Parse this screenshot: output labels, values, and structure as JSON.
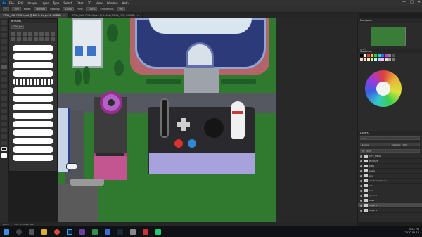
{
  "menubar": {
    "items": [
      "File",
      "Edit",
      "Image",
      "Layer",
      "Type",
      "Select",
      "Filter",
      "3D",
      "View",
      "Window",
      "Help"
    ],
    "window_controls": [
      "—",
      "□",
      "✕"
    ]
  },
  "options": {
    "size": "100",
    "mode_label": "Mode:",
    "mode": "Normal",
    "opacity_label": "Opacity:",
    "opacity": "100%",
    "flow_label": "Flow:",
    "flow": "100%",
    "smoothing_label": "Smoothing:",
    "smoothing": "0%"
  },
  "tabs": [
    {
      "label": "STRA_MAP FIN23.psd @ 200% (Layer 1, RGB/8)",
      "active": true
    },
    {
      "label": "STRA_MAP PIXELS.psd @ 100% (FINAL_REF, RGB/8)",
      "active": false
    }
  ],
  "brush_panel": {
    "title": "Brushes",
    "size_value": "100 px"
  },
  "navigator": {
    "title": "Navigator",
    "zoom": "200%"
  },
  "swatches": {
    "title": "Swatches"
  },
  "layers": {
    "title": "Layers",
    "kind": "Kind",
    "blend": "Normal",
    "opacity": "Opacity: 100%",
    "fill": "Fill: 100%",
    "rows": [
      {
        "name": "CITY_FINAL"
      },
      {
        "name": "HOUSES"
      },
      {
        "name": "KIDS"
      },
      {
        "name": "seats"
      },
      {
        "name": "sky"
      },
      {
        "name": "stadium shadow"
      },
      {
        "name": "stall"
      },
      {
        "name": "ball"
      },
      {
        "name": "ground"
      },
      {
        "name": "base"
      },
      {
        "name": "Layer 1",
        "active": true
      },
      {
        "name": "Layer 2"
      }
    ]
  },
  "status": {
    "zoom": "200%",
    "doc": "Doc: 8.52M/1.36G"
  },
  "taskbar": {
    "time": "3:09 PM",
    "date": "2020-02-18"
  }
}
